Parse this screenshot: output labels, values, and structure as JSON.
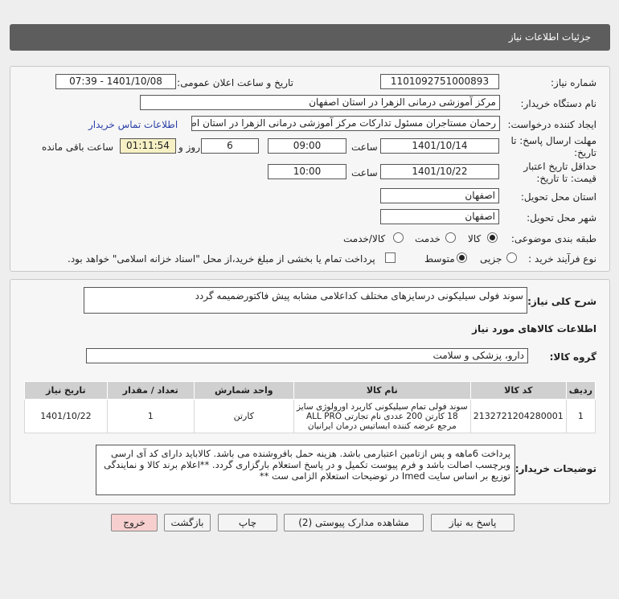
{
  "header": {
    "title": "جزئیات اطلاعات نیاز"
  },
  "info": {
    "need_number_label": "شماره نیاز:",
    "need_number": "1101092751000893",
    "announce_label": "تاریخ و ساعت اعلان عمومی:",
    "announce_value": "1401/10/08 - 07:39",
    "buyer_label": "نام دستگاه خریدار:",
    "buyer_value": "مرکز آموزشی درمانی الزهرا در استان اصفهان",
    "creator_label": "ایجاد کننده درخواست:",
    "creator_value": "رحمان مستاجران مسئول تدارکات مرکز آموزشی درمانی الزهرا در استان اصفهان",
    "contact_link": "اطلاعات تماس خریدار",
    "deadline_label_1": "مهلت ارسال پاسخ: تا",
    "deadline_label_2": "تاریخ:",
    "deadline_date": "1401/10/14",
    "time_label": "ساعت",
    "deadline_time": "09:00",
    "days_value": "6",
    "days_label": "روز و",
    "remaining_value": "01:11:54",
    "remaining_label": "ساعت باقی مانده",
    "validity_label_1": "حداقل تاریخ اعتبار",
    "validity_label_2": "قیمت: تا تاریخ:",
    "validity_date": "1401/10/22",
    "validity_time_label": "ساعت",
    "validity_time": "10:00",
    "province_label": "استان محل تحویل:",
    "province_value": "اصفهان",
    "city_label": "شهر محل تحویل:",
    "city_value": "اصفهان",
    "category_label": "طبقه بندی موضوعی:",
    "category_options": [
      "کالا",
      "خدمت",
      "کالا/خدمت"
    ],
    "purchase_label": "نوع فرآیند خرید :",
    "purchase_options": [
      "جزیی",
      "متوسط"
    ],
    "payment_note": "پرداخت تمام یا بخشی از مبلغ خرید،از محل \"اسناد خزانه اسلامی\" خواهد بود."
  },
  "details": {
    "summary_label": "شرح کلی نیاز:",
    "summary_value": "سوند فولی سیلیکونی درسایزهای مختلف  کداعلامی مشابه پیش فاکتورضمیمه گردد",
    "goods_info_title": "اطلاعات کالاهای مورد نیاز",
    "group_label": "گروه کالا:",
    "group_value": "دارو، پزشکی و سلامت",
    "table": {
      "headers": [
        "ردیف",
        "کد کالا",
        "نام کالا",
        "واحد شمارش",
        "تعداد / مقدار",
        "تاریخ نیاز"
      ],
      "rows": [
        [
          "1",
          "2132721204280001",
          "سوند فولی تمام سیلیکونی کاربرد اورولوژی سایز 18 کارتن 200 عددی نام تجارتی ALL PRO مرجع عرضه کننده ابساتیس درمان ایرانیان",
          "کارتن",
          "1",
          "1401/10/22"
        ]
      ]
    },
    "buyer_notes_label": "توضیحات خریدار:",
    "buyer_notes": "پرداخت 6ماهه و پس ازتامین اعتبارمی باشد. هزینه حمل بافروشنده می باشد. کالاباید دارای کد آی ارسی وبرچسب اصالت باشد و فرم پیوست تکمیل و در پاسخ استعلام بارگزاری گردد. **اعلام برند کالا و نمایندگی توزیع بر اساس سایت Imed در توضیحات استعلام الزامی ست **"
  },
  "buttons": {
    "reply": "پاسخ به نیاز",
    "attachments": "مشاهده مدارک پیوستی (2)",
    "print": "چاپ",
    "back": "بازگشت",
    "exit": "خروج"
  },
  "colors": {
    "titlebar": "#5d5d5d",
    "link": "#2a3ea6",
    "exit_button": "#f7cfcf",
    "remaining_box": "#f6f0c4"
  }
}
